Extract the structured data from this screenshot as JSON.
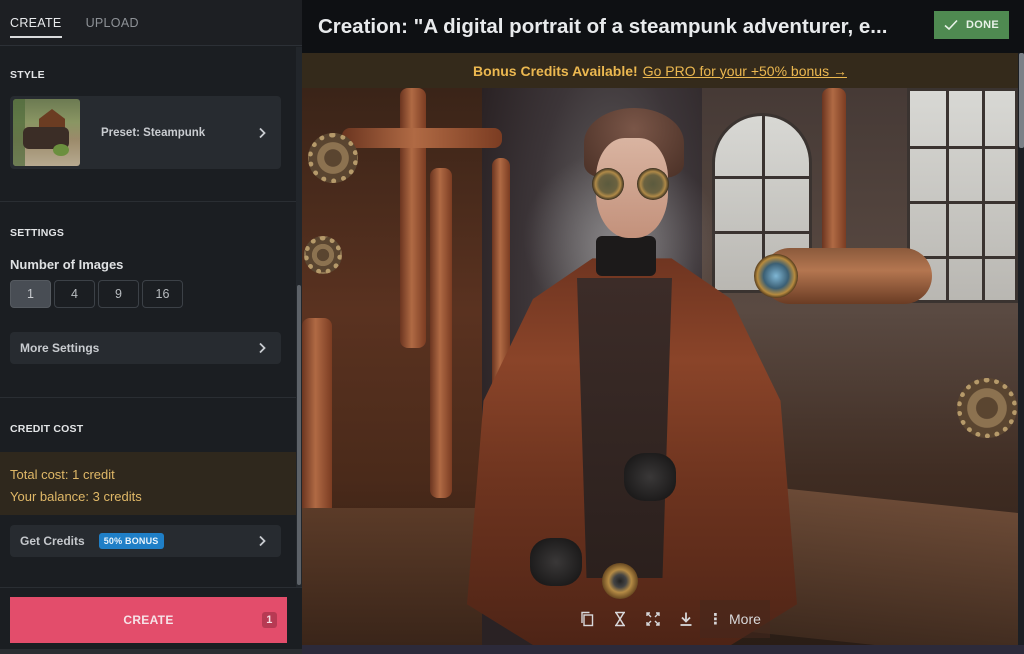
{
  "sidebar": {
    "tabs": [
      {
        "label": "CREATE",
        "active": true
      },
      {
        "label": "UPLOAD",
        "active": false
      }
    ],
    "style": {
      "title": "STYLE",
      "preset_label": "Preset: Steampunk"
    },
    "settings": {
      "title": "SETTINGS",
      "number_of_images_label": "Number of Images",
      "options": [
        "1",
        "4",
        "9",
        "16"
      ],
      "selected": "1",
      "more_settings_label": "More Settings"
    },
    "credit": {
      "title": "CREDIT COST",
      "total_cost": "Total cost: 1 credit",
      "balance": "Your balance: 3 credits",
      "get_credits_label": "Get Credits",
      "bonus_badge": "50% BONUS"
    },
    "create_button": {
      "label": "CREATE",
      "count": "1"
    }
  },
  "main": {
    "title": "Creation: \"A digital portrait of a steampunk adventurer, e...",
    "done_label": "DONE",
    "banner": {
      "strong": "Bonus Credits Available!",
      "link": "Go PRO for your +50% bonus →"
    },
    "image_alt": "A digital portrait of a steampunk adventurer in a workshop",
    "toolbar": {
      "icons": [
        "copy-icon",
        "hourglass-icon",
        "expand-icon",
        "download-icon"
      ],
      "more_label": "More"
    }
  },
  "colors": {
    "accent_create": "#e34d6b",
    "done_green": "#4f8a51",
    "banner_text": "#ecb850",
    "credit_text": "#e0b867",
    "bonus_badge": "#1f7fc7"
  }
}
